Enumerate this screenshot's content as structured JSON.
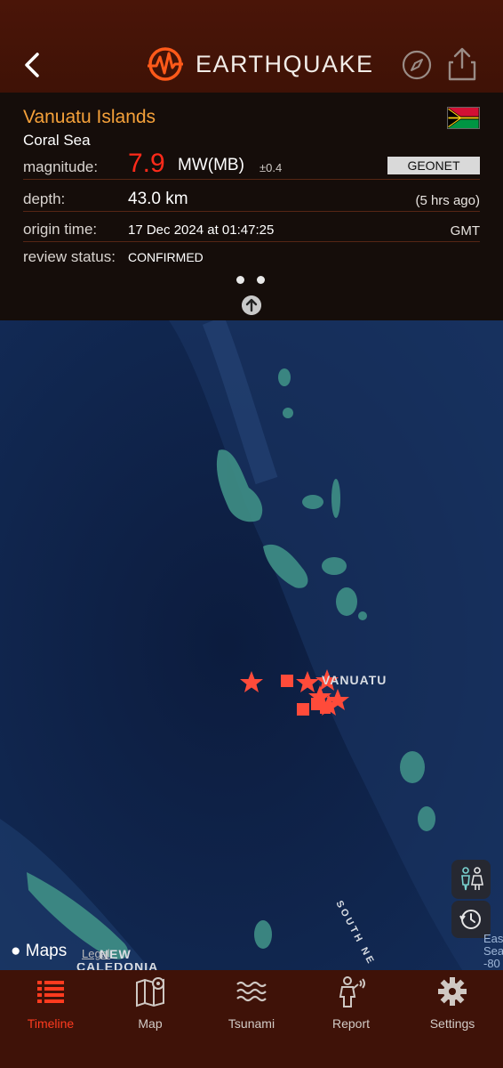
{
  "header": {
    "title": "EARTHQUAKE",
    "back_icon": "chevron-left-icon",
    "compass_icon": "compass-icon",
    "share_icon": "share-icon"
  },
  "event": {
    "region": "Vanuatu Islands",
    "subregion": "Coral Sea",
    "flag": "vanuatu-flag",
    "magnitude_label": "magnitude:",
    "magnitude_value": "7.9",
    "magnitude_unit": "MW(MB)",
    "magnitude_uncertainty": "±0.4",
    "source": "GEONET",
    "depth_label": "depth:",
    "depth_value": "43.0 km",
    "ago": "(5 hrs ago)",
    "origin_label": "origin time:",
    "origin_value": "17 Dec 2024 at 01:47:25",
    "timezone": "GMT",
    "review_label": "review status:",
    "review_value": "CONFIRMED"
  },
  "map": {
    "provider": "Maps",
    "legal": "Legal",
    "labels": {
      "country": "VANUATU",
      "new_caledonia_1": "NEW",
      "new_caledonia_2": "CALEDONIA",
      "sea": "SOUTH NE",
      "east_1": "Eas",
      "east_2": "Sea",
      "east_3": "-80"
    }
  },
  "tabs": [
    {
      "label": "Timeline",
      "icon": "list-icon",
      "active": true
    },
    {
      "label": "Map",
      "icon": "map-pin-icon",
      "active": false
    },
    {
      "label": "Tsunami",
      "icon": "waves-icon",
      "active": false
    },
    {
      "label": "Report",
      "icon": "person-report-icon",
      "active": false
    },
    {
      "label": "Settings",
      "icon": "gear-icon",
      "active": false
    }
  ],
  "colors": {
    "header_bg": "#4a1508",
    "accent_orange": "#f5a13a",
    "magnitude_red": "#ff2a1a",
    "active_tab": "#ff3b1f",
    "marker": "#ff4b3a"
  }
}
